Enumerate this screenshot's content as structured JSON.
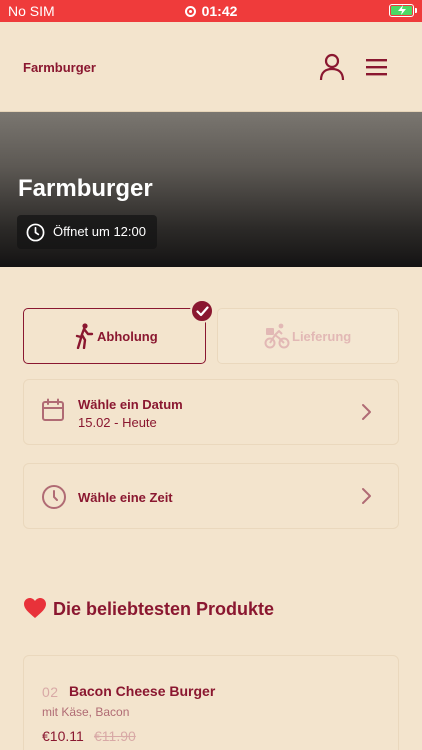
{
  "status_bar": {
    "carrier": "No SIM",
    "time": "01:42"
  },
  "header": {
    "brand": "Farmburger"
  },
  "hero": {
    "title": "Farmburger",
    "opening": "Öffnet um 12:00"
  },
  "order_mode": {
    "pickup_label": "Abholung",
    "delivery_label": "Lieferung",
    "selected": "pickup"
  },
  "date_picker": {
    "title": "Wähle ein Datum",
    "value": "15.02 - Heute"
  },
  "time_picker": {
    "title": "Wähle eine Zeit"
  },
  "popular": {
    "heading": "Die beliebtesten Produkte",
    "products": [
      {
        "number": "02",
        "name": "Bacon Cheese Burger",
        "description": "mit Käse, Bacon",
        "price": "€10.11",
        "old_price": "€11.90"
      }
    ]
  },
  "colors": {
    "accent": "#8a1730",
    "background": "#f3e4cd",
    "status_bar": "#ef3b3b",
    "muted": "#d8a9a6"
  }
}
